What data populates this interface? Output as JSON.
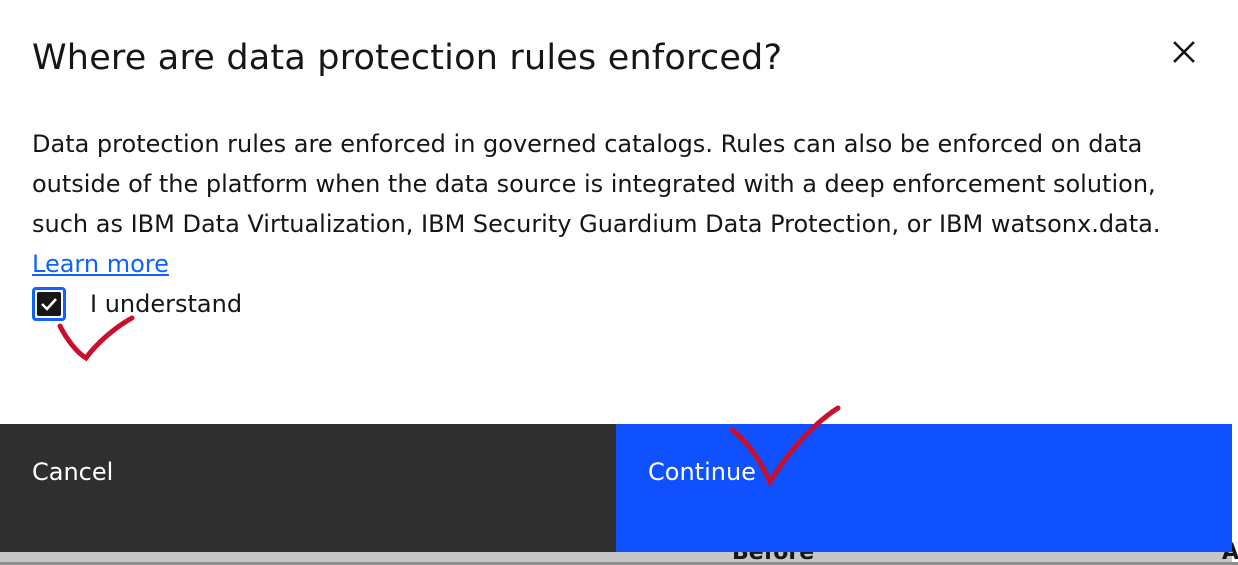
{
  "dialog": {
    "title": "Where are data protection rules enforced?",
    "body_text": "Data protection rules are enforced in governed catalogs. Rules can also be enforced on data outside of the platform when the data source is integrated with a deep enforcement solution, such as IBM Data Virtualization, IBM Security Guardium Data Protection, or IBM watsonx.data.",
    "learn_more_label": "Learn more",
    "checkbox_label": "I understand",
    "checkbox_checked": true,
    "close_icon": "close-icon"
  },
  "footer": {
    "cancel_label": "Cancel",
    "continue_label": "Continue"
  },
  "background": {
    "partial_text": "Before",
    "partial_text_right": "A"
  },
  "colors": {
    "primary_button": "#0f50ff",
    "secondary_button": "#2f2f2f",
    "link": "#0f62fe",
    "checkbox_focus": "#0f62fe",
    "annotation_mark": "#c8102e"
  },
  "annotations": [
    "red-checkmark-under-checkbox",
    "red-checkmark-over-continue"
  ]
}
